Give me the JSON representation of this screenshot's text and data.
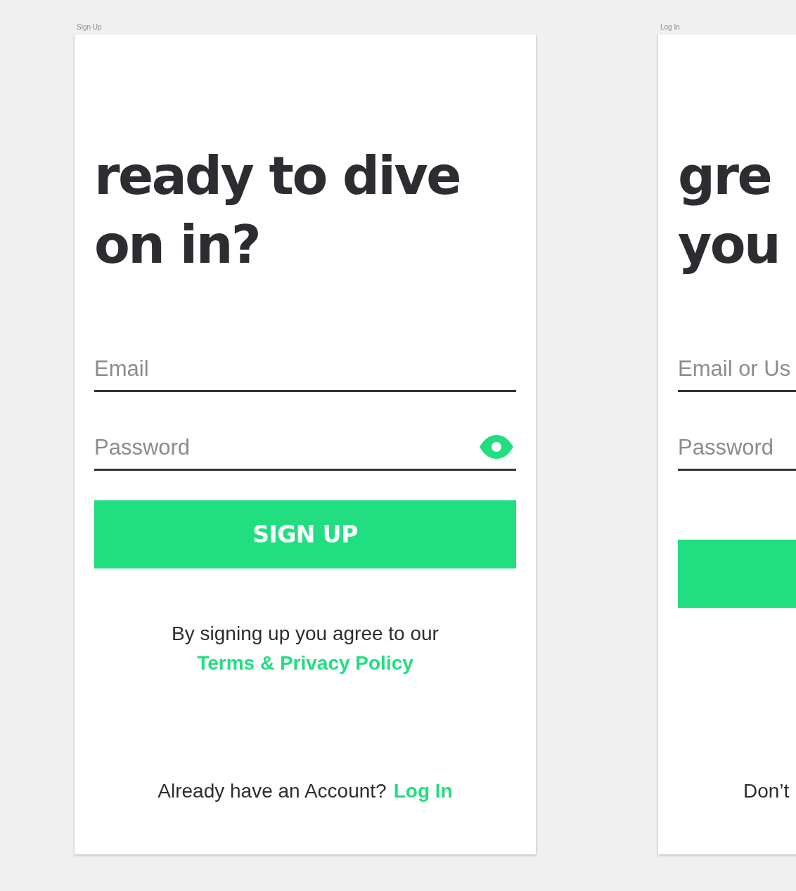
{
  "artboards": [
    {
      "name": "Sign Up",
      "kind": "signup",
      "heading": [
        "ready to dive",
        "on in?"
      ],
      "fields": [
        {
          "placeholder": "Email",
          "reveal_icon": false
        },
        {
          "placeholder": "Password",
          "reveal_icon": true
        }
      ],
      "button": {
        "kind": "primary",
        "label": "SIGN UP"
      },
      "terms": {
        "text": "By signing up you agree to our",
        "link": "Terms & Privacy Policy"
      },
      "footer": {
        "text": "Already have an Account?",
        "link": "Log In"
      }
    },
    {
      "name": "Log In",
      "kind": "login",
      "heading": [
        "gre",
        "you"
      ],
      "fields": [
        {
          "placeholder": "Email or Us",
          "reveal_icon": false
        },
        {
          "placeholder": "Password",
          "reveal_icon": false
        }
      ],
      "button": {
        "kind": "primary"
      },
      "footer": {
        "text": "Don’t"
      }
    }
  ]
}
